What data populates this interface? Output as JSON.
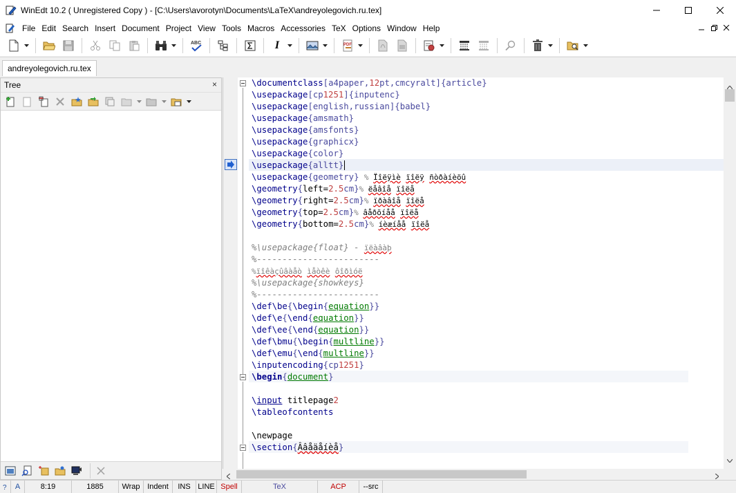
{
  "window": {
    "title": "WinEdt 10.2  ( Unregistered  Copy )  - [C:\\Users\\avorotyn\\Documents\\LaTeX\\andreyolegovich.ru.tex]",
    "controls": [
      "minimize-icon",
      "maximize-icon",
      "close-icon"
    ]
  },
  "menu": {
    "items": [
      "File",
      "Edit",
      "Search",
      "Insert",
      "Document",
      "Project",
      "View",
      "Tools",
      "Macros",
      "Accessories",
      "TeX",
      "Options",
      "Window",
      "Help"
    ],
    "mdi_controls": [
      "minimize-icon",
      "restore-icon",
      "close-icon"
    ]
  },
  "toolbar": {
    "icons": [
      "new-document-icon",
      "open-folder-icon",
      "save-icon",
      "cut-icon",
      "copy-icon",
      "paste-icon",
      "find-binoculars-icon",
      "spell-check-icon",
      "tree-structure-icon",
      "sigma-icon",
      "italic-icon",
      "image-icon",
      "pdf-icon",
      "pdf-document-icon",
      "pdf-document-2-icon",
      "compile-settings-icon",
      "texify-icon",
      "texify-2-icon",
      "search-icon",
      "trash-icon",
      "preview-icon"
    ],
    "italic_label": "I"
  },
  "tabs": [
    {
      "label": "andreyolegovich.ru.tex",
      "active": true
    }
  ],
  "tree_pane": {
    "title": "Tree",
    "close_label": "×"
  },
  "editor": {
    "current_line_index": 7
  },
  "statusbar": {
    "mode": "A",
    "position": "8:19",
    "chars": "1885",
    "wrap": "Wrap",
    "indent": "Indent",
    "ins": "INS",
    "line": "LINE",
    "spell": "Spell",
    "tex": "TeX",
    "acp": "ACP",
    "src": "--src",
    "colors": {
      "spell": "#c00000",
      "tex": "#4a4a9e",
      "acp": "#c00000"
    }
  }
}
